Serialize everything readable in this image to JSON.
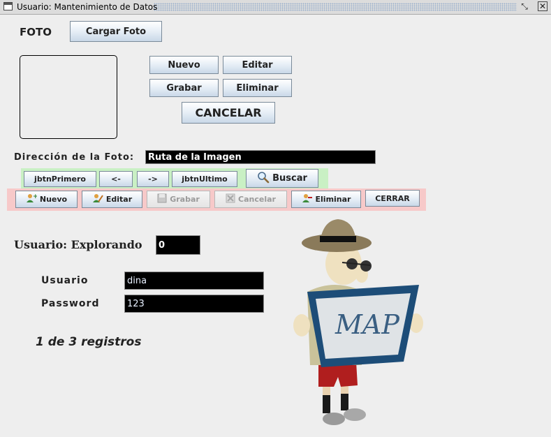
{
  "window": {
    "title": "Usuario: Mantenimiento de Datos",
    "restore_icon": "restore-icon",
    "close_icon": "close-icon"
  },
  "photo": {
    "label": "FOTO",
    "load_button": "Cargar Foto",
    "nuevo": "Nuevo",
    "editar": "Editar",
    "grabar": "Grabar",
    "eliminar": "Eliminar",
    "cancelar": "CANCELAR",
    "path_label": "Dirección de la Foto:",
    "path_value": "Ruta de la Imagen"
  },
  "navigation": {
    "first": "jbtnPrimero",
    "prev": "<-",
    "next": "->",
    "last": "jbtnUltimo",
    "search": "Buscar"
  },
  "crud": {
    "nuevo": "Nuevo",
    "editar": "Editar",
    "grabar": "Grabar",
    "cancelar": "Cancelar",
    "eliminar": "Eliminar",
    "cerrar": "CERRAR"
  },
  "form": {
    "mode_label": "Usuario: Explorando",
    "mode_value": "0",
    "usuario_label": "Usuario",
    "usuario_value": "dina",
    "password_label": "Password",
    "password_value": "123",
    "record_count": "1 de 3 registros"
  },
  "illustration": {
    "sign_text": "MAP"
  },
  "colors": {
    "nav_panel": "#c9f0c4",
    "crud_panel": "#f7c9c9",
    "field_bg": "#000000"
  }
}
